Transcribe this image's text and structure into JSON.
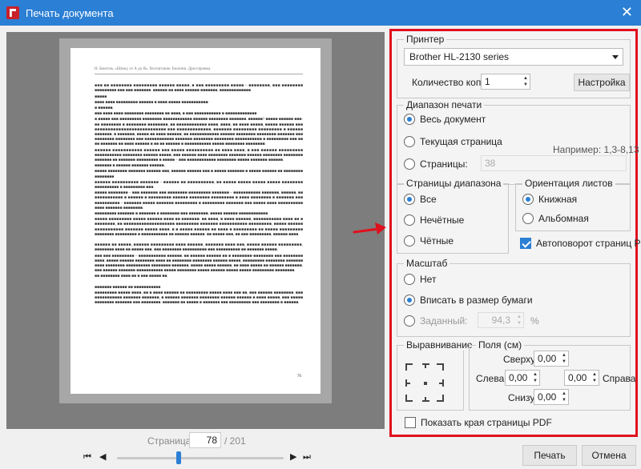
{
  "window": {
    "title": "Печать документа",
    "close": "✕"
  },
  "preview": {
    "header_text": "Н. Бекетов. «Шпиц: от А до Я». Воспитание. Болезни. Дрессировка.",
    "page_number": "76",
    "arrow_color": "#e0101e"
  },
  "pager": {
    "label": "Страница:",
    "current": "78",
    "total": "/ 201",
    "first": "⏮",
    "prev": "◀",
    "next": "▶",
    "last": "⏭"
  },
  "printer": {
    "title": "Принтер",
    "selected": "Brother HL-2130 series",
    "copies_label": "Количество копий",
    "copies_value": "1",
    "settings_button": "Настройка"
  },
  "range": {
    "title": "Диапазон печати",
    "all": "Весь документ",
    "current": "Текущая страница",
    "pages": "Страницы:",
    "pages_value": "38",
    "example": "Например: 1,3-8,13"
  },
  "subset": {
    "title": "Страницы диапазона",
    "all": "Все",
    "odd": "Нечётные",
    "even": "Чётные"
  },
  "orientation": {
    "title": "Ориентация листов",
    "portrait": "Книжная",
    "landscape": "Альбомная",
    "auto_rotate": "Автоповорот страниц PDF"
  },
  "scale": {
    "title": "Масштаб",
    "none": "Нет",
    "fit": "Вписать в размер бумаги",
    "custom": "Заданный:",
    "custom_value": "94,3",
    "percent": "%"
  },
  "alignment": {
    "title": "Выравнивание"
  },
  "margins": {
    "title": "Поля (см)",
    "top_label": "Сверху",
    "top": "0,00",
    "left_label": "Слева",
    "left": "0,00",
    "right_label": "Справа",
    "right": "0,00",
    "bottom_label": "Снизу",
    "bottom": "0,00"
  },
  "show_edges": "Показать края страницы PDF",
  "buttons": {
    "print": "Печать",
    "cancel": "Отмена"
  },
  "colors": {
    "titlebar": "#2b7fd4",
    "accent": "#2b7fd4",
    "highlight_border": "#e0101e"
  }
}
